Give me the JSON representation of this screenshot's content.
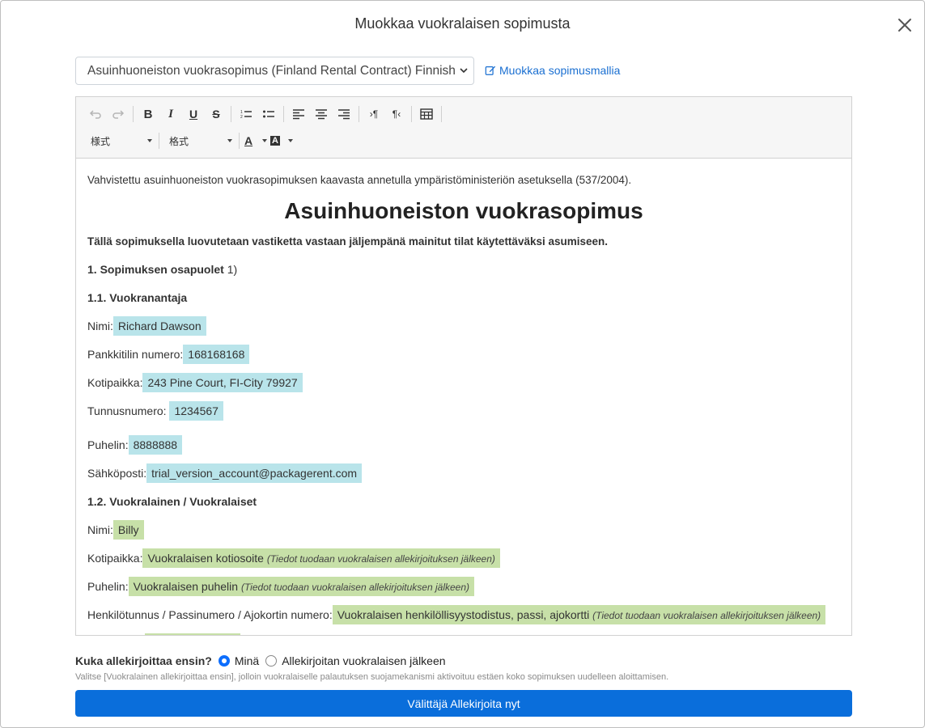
{
  "modal": {
    "title": "Muokkaa vuokralaisen sopimusta"
  },
  "template": {
    "selected": "Asuinhuoneiston vuokrasopimus (Finland Rental Contract) Finnish",
    "edit_link": "Muokkaa sopimusmallia"
  },
  "toolbar": {
    "style_combo": "様式",
    "format_combo": "格式",
    "icons": [
      "undo-icon",
      "redo-icon",
      "bold-icon",
      "italic-icon",
      "underline-icon",
      "strikethrough-icon",
      "numbered-list-icon",
      "bullet-list-icon",
      "align-left-icon",
      "align-center-icon",
      "align-right-icon",
      "ltr-icon",
      "rtl-icon",
      "table-icon",
      "text-color-icon",
      "background-color-icon"
    ]
  },
  "document": {
    "intro": "Vahvistettu asuinhuoneiston vuokrasopimuksen kaavasta annetulla ympäristöministeriön asetuksella (537/2004).",
    "title": "Asuinhuoneiston vuokrasopimus",
    "subtitle": "Tällä sopimuksella luovutetaan vastiketta vastaan jäljempänä mainitut tilat käytettäväksi asumiseen.",
    "section1": "1. Sopimuksen osapuolet",
    "section1_note": " 1)",
    "landlord_heading": "1.1. Vuokranantaja",
    "landlord": {
      "name_label": "Nimi:",
      "name": "Richard Dawson",
      "bank_label": "Pankkitilin numero:",
      "bank": "168168168",
      "home_label": "Kotipaikka:",
      "home": "243 Pine Court, FI-City 79927",
      "id_label": "Tunnusnumero:",
      "id": "1234567",
      "phone_label": "Puhelin:",
      "phone": "8888888",
      "email_label": "Sähköposti:",
      "email": "trial_version_account@packagerent.com"
    },
    "tenant_heading": "1.2. Vuokralainen / Vuokralaiset",
    "tenant": {
      "name_label": "Nimi:",
      "name": "Billy",
      "home_label": "Kotipaikka:",
      "home": "Vuokralaisen kotiosoite",
      "phone_label": "Puhelin:",
      "phone": "Vuokralaisen puhelin",
      "id_label": "Henkilötunnus / Passinumero / Ajokortin numero:",
      "id": "Vuokralaisen henkilöllisyystodistus, passi, ajokortti",
      "note": "(Tiedot tuodaan vuokralaisen allekirjoituksen jälkeen)"
    }
  },
  "signing": {
    "question": "Kuka allekirjoittaa ensin?",
    "option_me": "Minä",
    "option_after": "Allekirjoitan vuokralaisen jälkeen",
    "hint": "Valitse [Vuokralainen allekirjoittaa ensin], jolloin vuokralaiselle palautuksen suojamekanismi aktivoituu estäen koko sopimuksen uudelleen aloittamisen.",
    "button": "Välittäjä Allekirjoita nyt"
  },
  "colors": {
    "landlord_highlight": "#b9e4ea",
    "tenant_highlight": "#c7e0a8",
    "primary": "#0a6edb"
  }
}
